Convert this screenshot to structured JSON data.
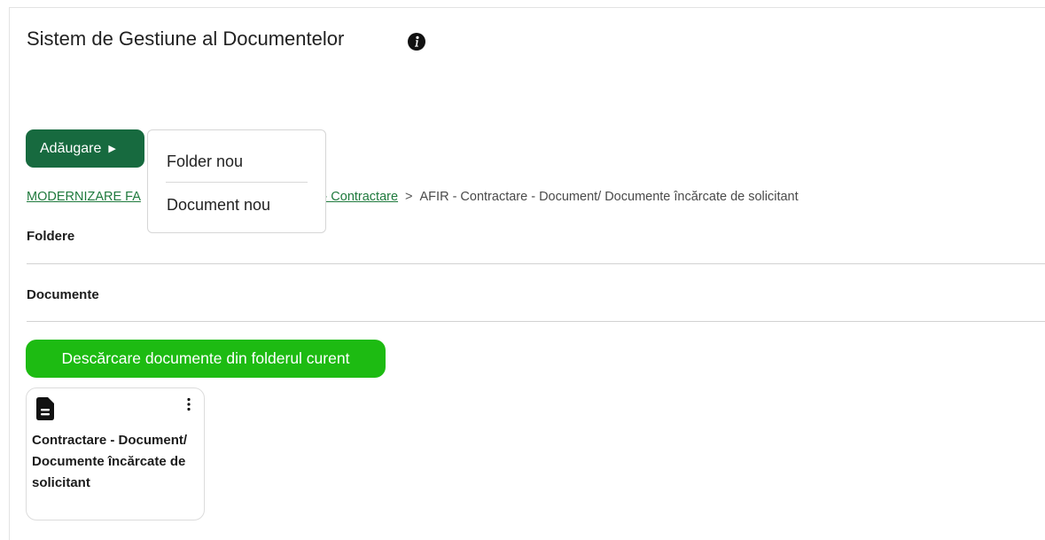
{
  "page": {
    "title": "Sistem de Gestiune al Documentelor",
    "info_icon": "info-circle-icon"
  },
  "toolbar": {
    "add_label": "Adăugare",
    "add_caret_icon": "caret-right-icon",
    "add_color": "#176a3f"
  },
  "add_menu": {
    "items": [
      {
        "label": "Folder nou"
      },
      {
        "label": "Document nou"
      }
    ]
  },
  "breadcrumb": {
    "items": [
      {
        "label": "MODERNIZARE FA",
        "link": true
      },
      {
        "label": "AFIR - Contractare",
        "link": true
      },
      {
        "label": "AFIR - Contractare - Document/ Documente încărcate de solicitant",
        "link": false
      }
    ],
    "separator": ">",
    "link_color": "#1f7a3d"
  },
  "sections": {
    "folders_label": "Foldere",
    "documents_label": "Documente"
  },
  "download": {
    "label": "Descărcare documente din folderul curent",
    "color": "#1dbb12"
  },
  "documents": [
    {
      "title": "Contractare - Document/ Documente încărcate de solicitant",
      "icon": "document-icon",
      "menu_icon": "kebab-menu-icon"
    }
  ]
}
